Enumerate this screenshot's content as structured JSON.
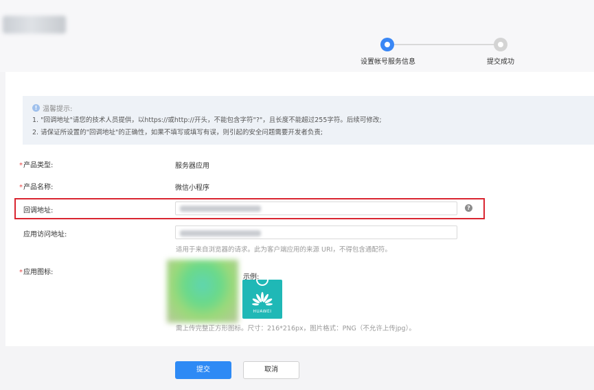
{
  "stepper": {
    "steps": [
      {
        "label": "设置帐号服务信息",
        "state": "active"
      },
      {
        "label": "提交成功",
        "state": "inactive"
      }
    ],
    "active_color": "#3a87f5"
  },
  "notice": {
    "title": "温馨提示:",
    "lines": [
      "1. \"回调地址\"请您的技术人员提供，以https://或http://开头，不能包含字符\"?\"，且长度不能超过255字符。后续可修改;",
      "2. 请保证所设置的\"回调地址\"的正确性，如果不填写或填写有误，则引起的安全问题需要开发者负责;"
    ]
  },
  "form": {
    "required_mark": "*",
    "product_type": {
      "label": "产品类型:",
      "value": "服务器应用"
    },
    "product_name": {
      "label": "产品名称:",
      "value": "微信小程序"
    },
    "callback_url": {
      "label": "回调地址:",
      "help_icon": "?"
    },
    "access_url": {
      "label": "应用访问地址:",
      "hint": "适用于来自浏览器的请求。此为客户端应用的来源 URI，不得包含通配符。"
    },
    "app_icon": {
      "label": "应用图标:",
      "example_label": "示例:",
      "example_brand": "HUAWEI",
      "hint": "需上传完整正方形图标。尺寸：216*216px，图片格式：PNG（不允许上传jpg）。"
    }
  },
  "buttons": {
    "submit": "提交",
    "cancel": "取消"
  },
  "colors": {
    "highlight_border": "#d9232e",
    "primary_button": "#2e8af5",
    "example_icon_bg": "#1fb8b6"
  }
}
